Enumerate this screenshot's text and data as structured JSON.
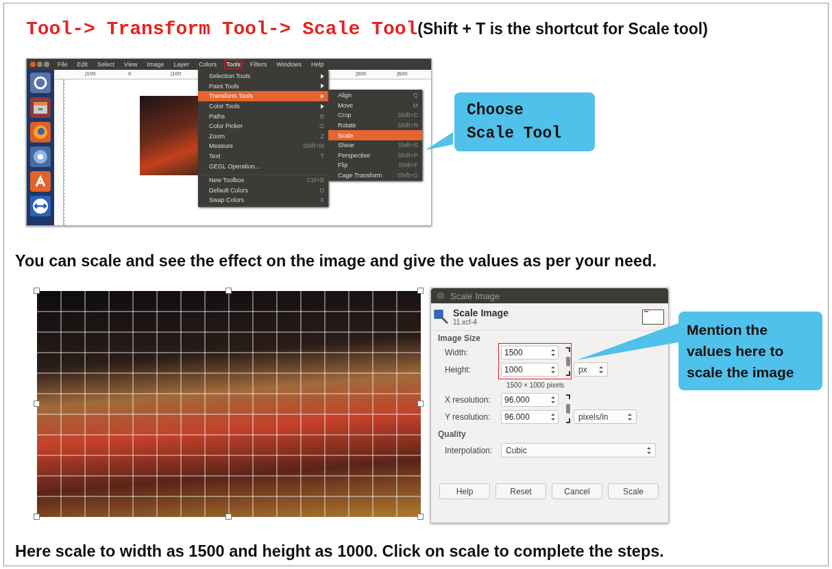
{
  "heading": {
    "path": "Tool-> Transform Tool-> Scale Tool",
    "note": "(Shift + T is the shortcut for Scale tool)"
  },
  "gimp_window": {
    "menubar": [
      {
        "label": "File",
        "selected": false
      },
      {
        "label": "Edit",
        "selected": false
      },
      {
        "label": "Select",
        "selected": false
      },
      {
        "label": "View",
        "selected": false
      },
      {
        "label": "Image",
        "selected": false
      },
      {
        "label": "Layer",
        "selected": false
      },
      {
        "label": "Colors",
        "selected": false
      },
      {
        "label": "Tools",
        "selected": true
      },
      {
        "label": "Filters",
        "selected": false
      },
      {
        "label": "Windows",
        "selected": false
      },
      {
        "label": "Help",
        "selected": false
      }
    ],
    "ruler_labels": [
      "|100",
      "0",
      "|100",
      "|500",
      "|600"
    ],
    "tools_menu": [
      {
        "label": "Selection Tools",
        "submenu": true,
        "separator_before": false,
        "selected": false
      },
      {
        "label": "Paint Tools",
        "submenu": true,
        "separator_before": false,
        "selected": false
      },
      {
        "label": "Transform Tools",
        "submenu": true,
        "separator_before": false,
        "selected": true
      },
      {
        "label": "Color Tools",
        "submenu": true,
        "separator_before": false,
        "selected": false
      },
      {
        "label": "Paths",
        "shortcut": "B",
        "submenu": false,
        "separator_before": false,
        "selected": false
      },
      {
        "label": "Color Picker",
        "shortcut": "O",
        "submenu": false,
        "separator_before": false,
        "selected": false
      },
      {
        "label": "Zoom",
        "shortcut": "Z",
        "submenu": false,
        "separator_before": false,
        "selected": false
      },
      {
        "label": "Measure",
        "shortcut": "Shift+M",
        "submenu": false,
        "separator_before": false,
        "selected": false
      },
      {
        "label": "Text",
        "shortcut": "T",
        "submenu": false,
        "separator_before": false,
        "selected": false
      },
      {
        "label": "GEGL Operation...",
        "submenu": false,
        "separator_before": false,
        "selected": false
      },
      {
        "label": "New Toolbox",
        "shortcut": "Ctrl+B",
        "submenu": false,
        "separator_before": true,
        "selected": false
      },
      {
        "label": "Default Colors",
        "shortcut": "D",
        "submenu": false,
        "separator_before": false,
        "selected": false
      },
      {
        "label": "Swap Colors",
        "shortcut": "X",
        "submenu": false,
        "separator_before": false,
        "selected": false
      }
    ],
    "transform_submenu": [
      {
        "label": "Align",
        "shortcut": "Q",
        "selected": false
      },
      {
        "label": "Move",
        "shortcut": "M",
        "selected": false
      },
      {
        "label": "Crop",
        "shortcut": "Shift+C",
        "selected": false
      },
      {
        "label": "Rotate",
        "shortcut": "Shift+R",
        "selected": false
      },
      {
        "label": "Scale",
        "selected": true
      },
      {
        "label": "Shear",
        "shortcut": "Shift+S",
        "selected": false
      },
      {
        "label": "Perspective",
        "shortcut": "Shift+P",
        "selected": false
      },
      {
        "label": "Flip",
        "shortcut": "Shift+F",
        "selected": false
      },
      {
        "label": "Cage Transform",
        "shortcut": "Shift+G",
        "selected": false
      }
    ]
  },
  "callout_1": [
    "Choose",
    "Scale Tool"
  ],
  "instruction": "You can scale and see the effect on the image and give the values as per your need.",
  "scale_dialog": {
    "title": "Scale Image",
    "header": "Scale Image",
    "subtitle": "11.xcf-4",
    "image_size_label": "Image Size",
    "size_fields": [
      {
        "label": "Width:",
        "value": "1500"
      },
      {
        "label": "Height:",
        "value": "1000"
      }
    ],
    "size_unit": "px",
    "pixel_summary": "1500 × 1000 pixels",
    "resolution_fields": [
      {
        "label": "X resolution:",
        "value": "96.000"
      },
      {
        "label": "Y resolution:",
        "value": "96.000"
      }
    ],
    "resolution_unit": "pixels/in",
    "quality_label": "Quality",
    "interpolation": {
      "label": "Interpolation:",
      "value": "Cubic"
    },
    "buttons": [
      "Help",
      "Reset",
      "Cancel",
      "Scale"
    ]
  },
  "callout_2": [
    "Mention the",
    "values here to",
    "scale the image"
  ],
  "footer": "Here scale to width as 1500 and height as 1000.  Click on scale to complete the steps."
}
